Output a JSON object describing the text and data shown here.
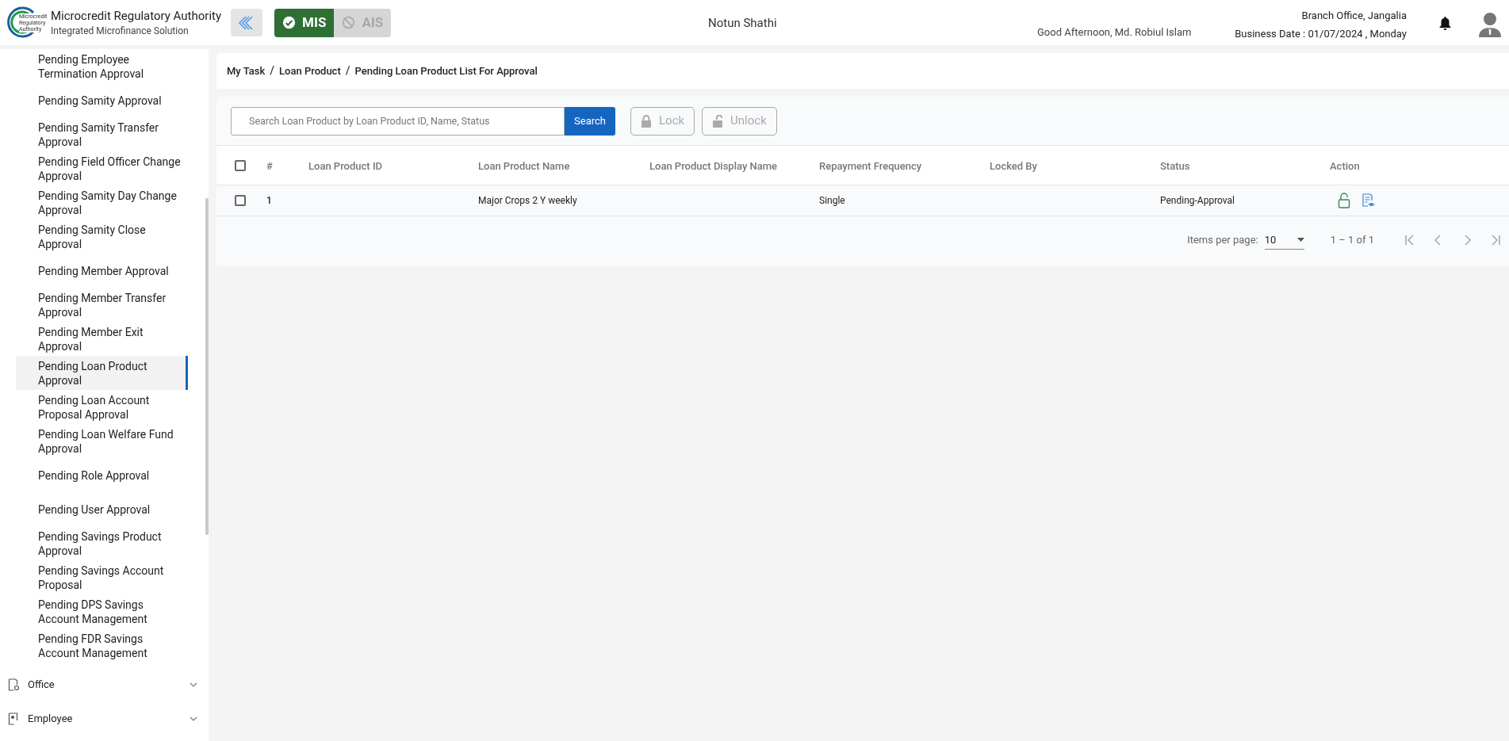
{
  "header": {
    "logo_text": [
      "Microcredit",
      "Regulatory",
      "Authority"
    ],
    "title": "Microcredit Regulatory Authority",
    "subtitle": "Integrated Microfinance Solution",
    "modules": [
      {
        "label": "MIS",
        "selected": true
      },
      {
        "label": "AIS",
        "selected": false
      }
    ],
    "center_title": "Notun Shathi",
    "greeting": "Good Afternoon, Md. Robiul Islam",
    "branch": "Branch Office, Jangalia",
    "business_date": "Business Date : 01/07/2024 , Monday"
  },
  "sidebar": {
    "items": [
      {
        "label": "Pending Employee Termination Approval",
        "selected": false
      },
      {
        "label": "Pending Samity Approval",
        "selected": false
      },
      {
        "label": "Pending Samity Transfer Approval",
        "selected": false
      },
      {
        "label": "Pending Field Officer Change Approval",
        "selected": false
      },
      {
        "label": "Pending Samity Day Change Approval",
        "selected": false
      },
      {
        "label": "Pending Samity Close Approval",
        "selected": false
      },
      {
        "label": "Pending Member Approval",
        "selected": false
      },
      {
        "label": "Pending Member Transfer Approval",
        "selected": false
      },
      {
        "label": "Pending Member Exit Approval",
        "selected": false
      },
      {
        "label": "Pending Loan Product Approval",
        "selected": true
      },
      {
        "label": "Pending Loan Account Proposal Approval",
        "selected": false
      },
      {
        "label": "Pending Loan Welfare Fund Approval",
        "selected": false
      },
      {
        "label": "Pending Role Approval",
        "selected": false
      },
      {
        "label": "Pending User Approval",
        "selected": false
      },
      {
        "label": "Pending Savings Product Approval",
        "selected": false
      },
      {
        "label": "Pending Savings Account Proposal",
        "selected": false
      },
      {
        "label": "Pending DPS Savings Account Management",
        "selected": false
      },
      {
        "label": "Pending FDR Savings Account Management",
        "selected": false
      }
    ],
    "sections": [
      {
        "label": "Office",
        "expanded": false
      },
      {
        "label": "Employee",
        "expanded": false
      }
    ]
  },
  "breadcrumb": {
    "separator": "/",
    "items": [
      "My Task",
      "Loan Product",
      "Pending Loan Product List For Approval"
    ]
  },
  "search": {
    "placeholder": "Search Loan Product by Loan Product ID, Name, Status",
    "button": "Search"
  },
  "toolbar": [
    {
      "label": "Lock",
      "kind": "lock",
      "disabled": true
    },
    {
      "label": "Unlock",
      "kind": "unlock",
      "disabled": true
    }
  ],
  "table": {
    "select_all_checked": false,
    "columns": [
      "#",
      "Loan Product ID",
      "Loan Product Name",
      "Loan Product Display Name",
      "Repayment Frequency",
      "Locked By",
      "Status",
      "Action"
    ],
    "rows": [
      {
        "checked": false,
        "cells": [
          "1",
          "",
          "Major Crops 2 Y weekly",
          "",
          "Single",
          "",
          "Pending-Approval"
        ]
      }
    ]
  },
  "pagination": {
    "label": "Items per page:",
    "page_size": "10",
    "range": "1 – 1 of 1"
  }
}
